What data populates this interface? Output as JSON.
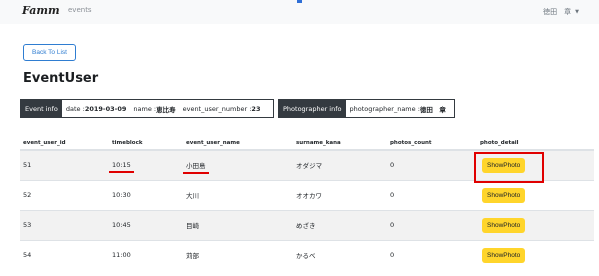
{
  "nav": {
    "brand": "Famm",
    "link": "events",
    "user": "徳田　章"
  },
  "back_label": "Back To List",
  "page_title": "EventUser",
  "event_info": {
    "tag": "Event info",
    "date_label": "date : ",
    "date_value": "2019-03-09",
    "name_label": "name : ",
    "name_value": "恵比寿",
    "number_label": "event_user_number : ",
    "number_value": "23"
  },
  "photographer_info": {
    "tag": "Photographer info",
    "label": "photographer_name : ",
    "value": "徳田　章"
  },
  "table": {
    "headers": [
      "event_user_id",
      "timeblock",
      "event_user_name",
      "surname_kana",
      "photos_count",
      "photo_detail"
    ],
    "rows": [
      {
        "id": "51",
        "time": "10:15",
        "name": "小田島",
        "kana": "オダジマ",
        "count": "0",
        "action": "ShowPhoto"
      },
      {
        "id": "52",
        "time": "10:30",
        "name": "大川",
        "kana": "オオカワ",
        "count": "0",
        "action": "ShowPhoto"
      },
      {
        "id": "53",
        "time": "10:45",
        "name": "目崎",
        "kana": "めざき",
        "count": "0",
        "action": "ShowPhoto"
      },
      {
        "id": "54",
        "time": "11:00",
        "name": "苅部",
        "kana": "かるべ",
        "count": "0",
        "action": "ShowPhoto"
      }
    ]
  },
  "colors": {
    "accent_blue": "#2f7dd1",
    "dark_tag": "#343a40",
    "button_yellow": "#ffd52b",
    "highlight_red": "#e00000"
  }
}
